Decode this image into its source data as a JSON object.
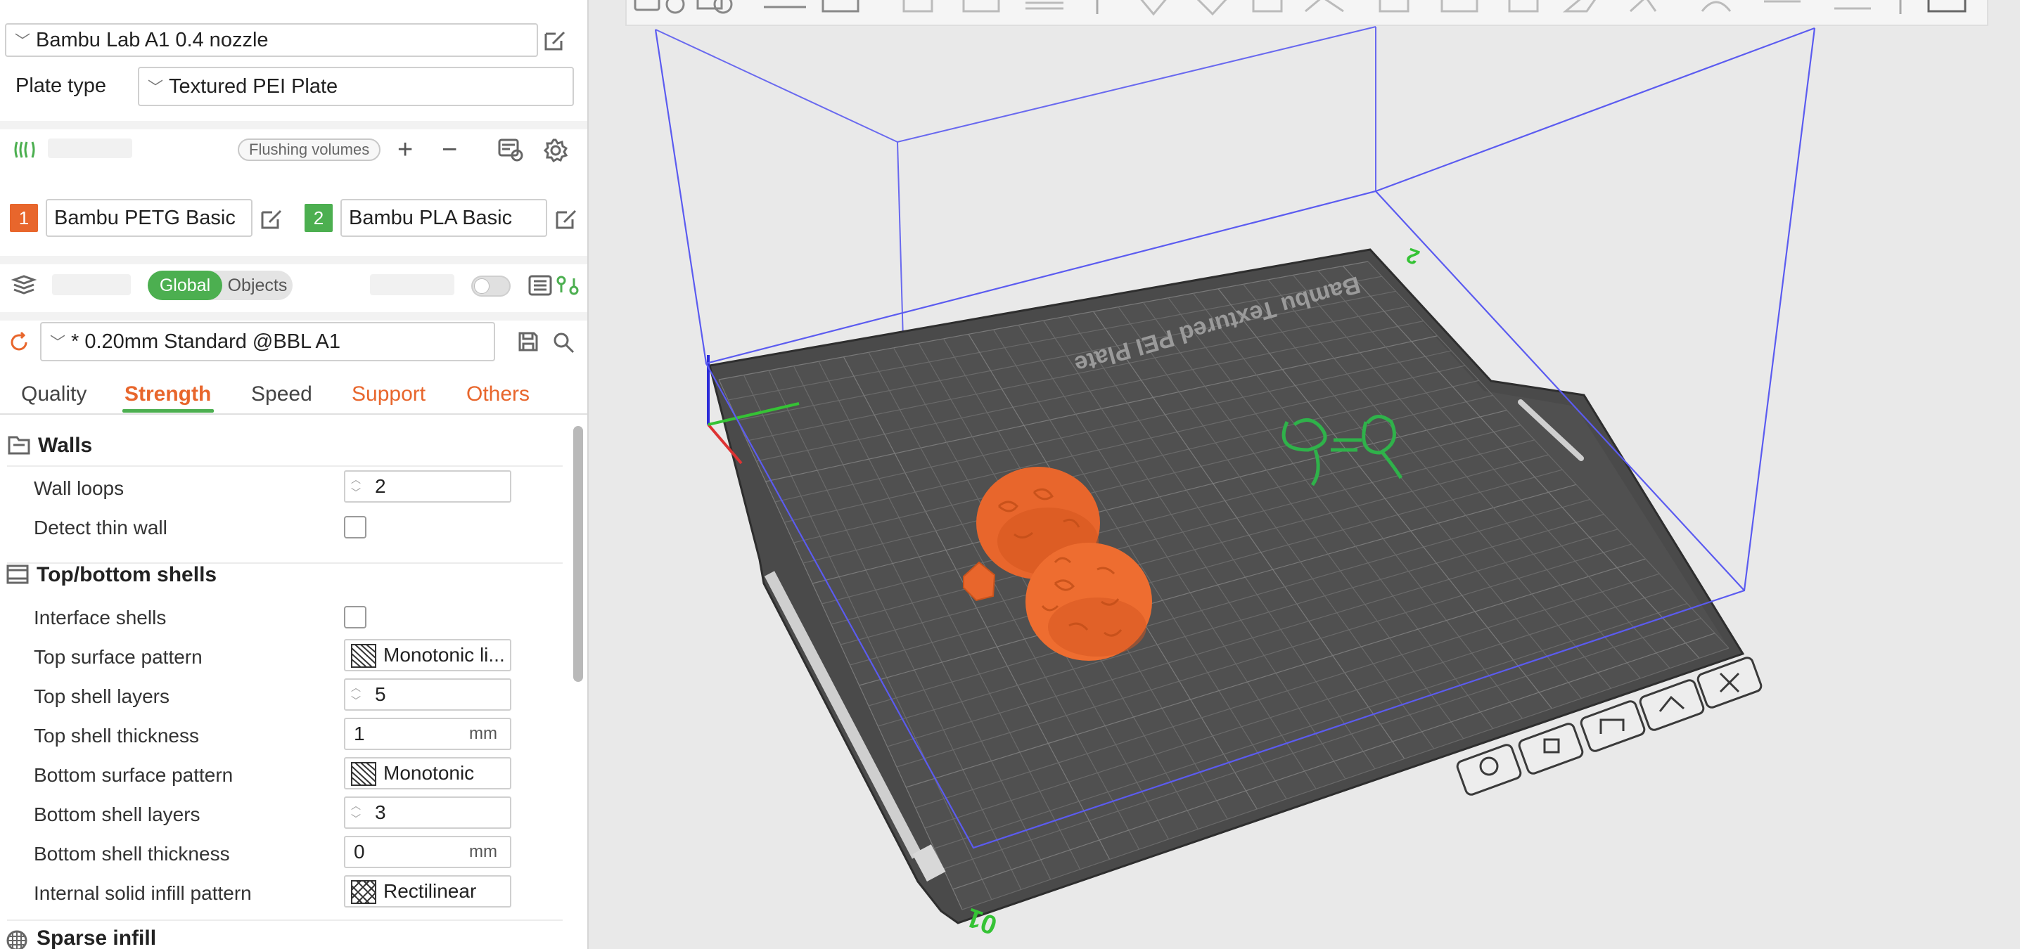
{
  "printer": {
    "name": "Bambu Lab A1 0.4 nozzle"
  },
  "plate": {
    "label": "Plate type",
    "value": "Textured PEI Plate"
  },
  "filament_bar": {
    "flushing_label": "Flushing volumes"
  },
  "filaments": [
    {
      "index": "1",
      "name": "Bambu PETG Basic",
      "color": "#e8662c"
    },
    {
      "index": "2",
      "name": "Bambu PLA Basic",
      "color": "#4caf50"
    }
  ],
  "process_bar": {
    "global_label": "Global",
    "objects_label": "Objects"
  },
  "process": {
    "preset": "* 0.20mm Standard @BBL A1"
  },
  "tabs": [
    "Quality",
    "Strength",
    "Speed",
    "Support",
    "Others"
  ],
  "groups": {
    "walls": "Walls",
    "shells": "Top/bottom shells",
    "sparse": "Sparse infill"
  },
  "options": {
    "wall_loops": {
      "label": "Wall loops",
      "value": "2"
    },
    "detect_thin_wall": {
      "label": "Detect thin wall"
    },
    "interface_shells": {
      "label": "Interface shells"
    },
    "top_surface_pattern": {
      "label": "Top surface pattern",
      "value": "Monotonic li..."
    },
    "top_shell_layers": {
      "label": "Top shell layers",
      "value": "5"
    },
    "top_shell_thickness": {
      "label": "Top shell thickness",
      "value": "1",
      "unit": "mm"
    },
    "bottom_surface_pattern": {
      "label": "Bottom surface pattern",
      "value": "Monotonic"
    },
    "bottom_shell_layers": {
      "label": "Bottom shell layers",
      "value": "3"
    },
    "bottom_shell_thickness": {
      "label": "Bottom shell thickness",
      "value": "0",
      "unit": "mm"
    },
    "internal_solid_infill_pattern": {
      "label": "Internal solid infill pattern",
      "value": "Rectilinear"
    }
  },
  "viewport": {
    "plate_text": "Bambu Textured PEI Plate",
    "plate_number": "01",
    "model_color": "#e8662c",
    "accent_color": "#4caf50",
    "volume_color": "#5b5bf0"
  }
}
